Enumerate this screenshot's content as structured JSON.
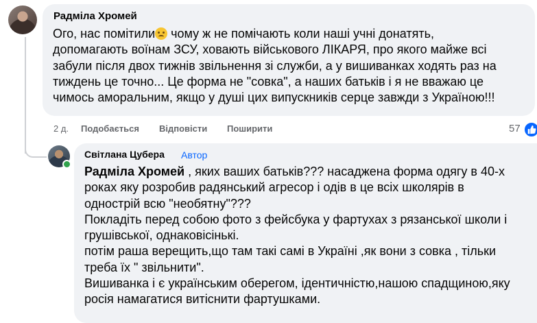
{
  "comment1": {
    "author": "Радміла Хромей",
    "lines": [
      "Ого, нас помітили",
      "допомагають воїнам ЗСУ, ховають військового ЛІКАРЯ, про якого майже всі",
      "забули після двох тижнів звільнення зі служби, а у вишиванках ходять раз на",
      "тиждень це точно... Це форма не \"совка\", а наших батьків і я не вважаю це",
      "чимось аморальним, якщо у душі цих випускників серце завжди з Україною!!!"
    ],
    "line1_after_emoji": " чому ж не помічають коли наші учні донатять,",
    "emoji": "crying-face-emoji",
    "time": "2 д.",
    "like_label": "Подобається",
    "reply_label": "Відповісти",
    "share_label": "Поширити",
    "reaction_count": "57"
  },
  "comment2": {
    "author": "Світлана Цубера",
    "badge": "Автор",
    "mention": "Радміла Хромей",
    "line1_after_mention": " , яких ваших батьків??? насаджена форма одягу в 40-х",
    "lines": [
      "роках яку розробив радянський агресор і одів в це всіх школярів в",
      "однострій всю \"необятну\"???",
      "Покладіть перед собою фото з фейсбука у фартухах з рязанської школи і",
      "грушівської, однаковісінькі.",
      "потім раша верещить,що там такі самі в Україні ,як вони з совка , тільки",
      "треба їх \" звільнити\".",
      "Вишиванка і є українським оберегом, ідентичністю,нашою спадщиною,яку",
      "росія намагатися витіснити фартушками."
    ]
  },
  "colors": {
    "like_blue": "#0866ff",
    "bubble": "#f0f2f5",
    "meta": "#65676b"
  }
}
